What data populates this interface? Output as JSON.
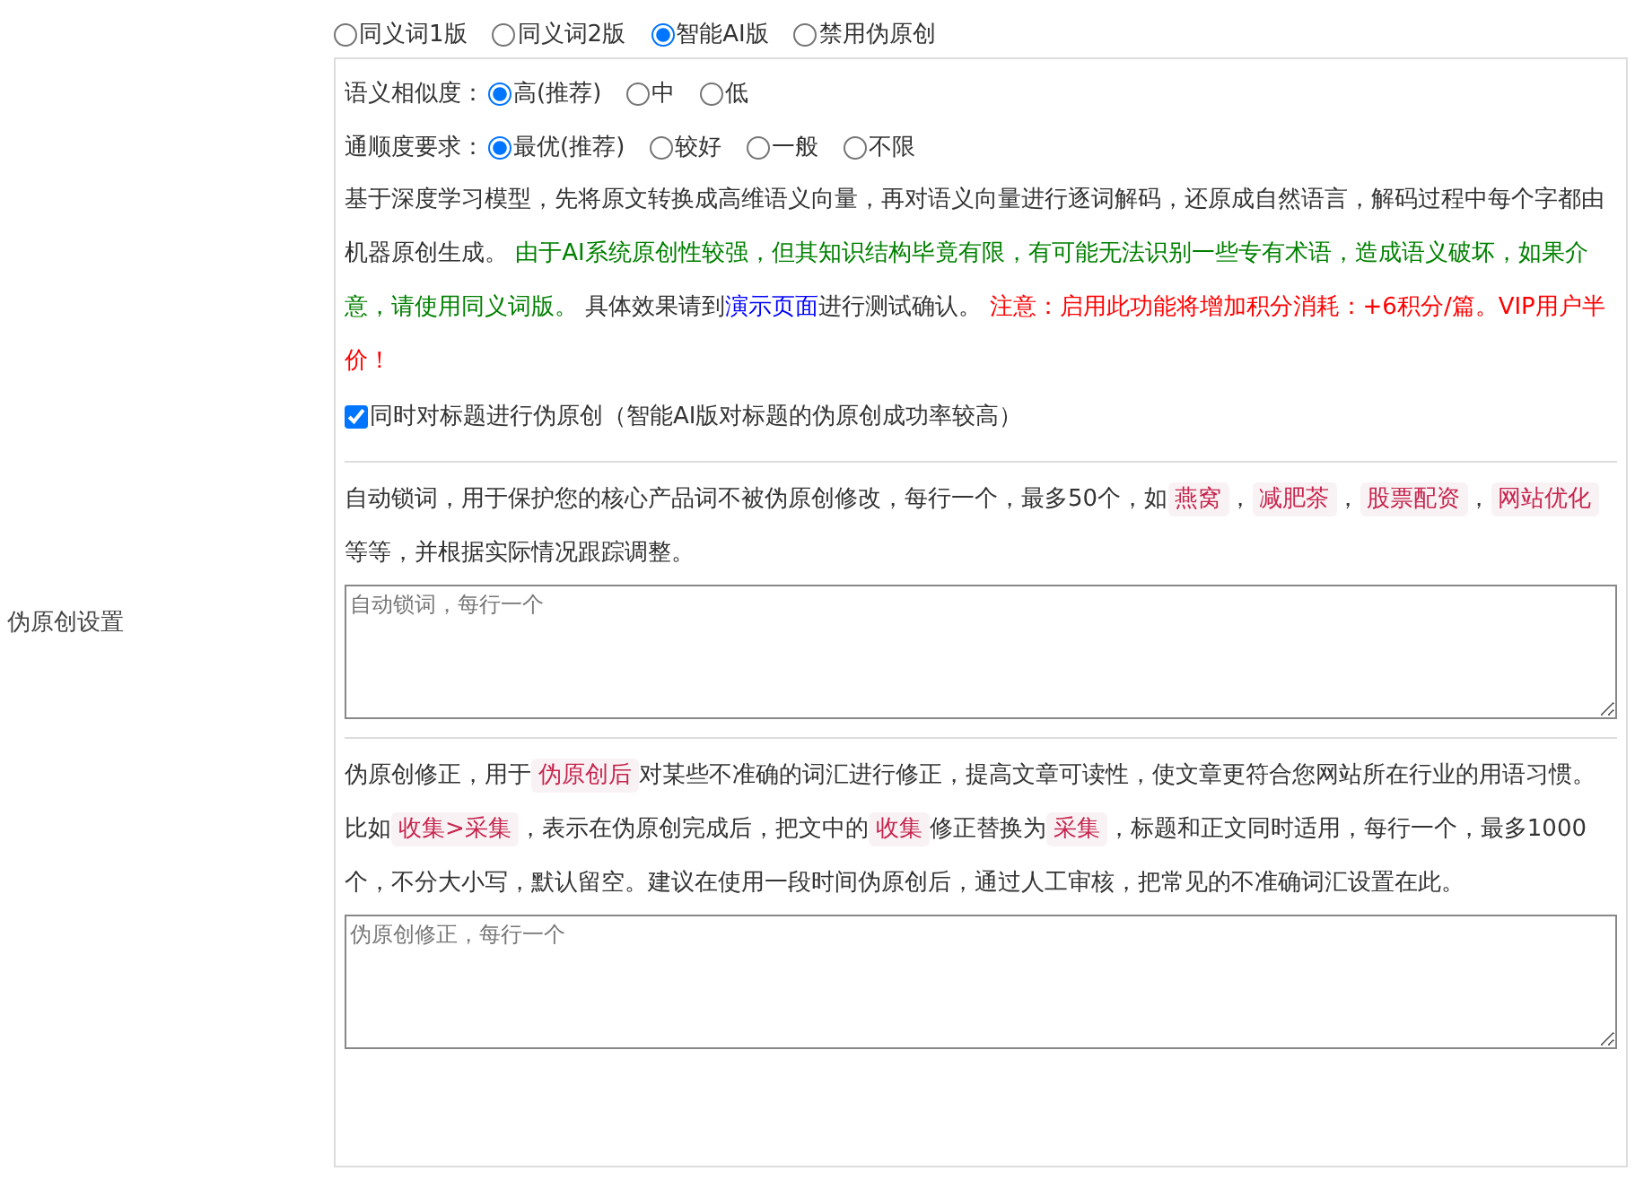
{
  "section_label": "伪原创设置",
  "mode_options": [
    {
      "label": "同义词1版",
      "selected": false
    },
    {
      "label": "同义词2版",
      "selected": false
    },
    {
      "label": "智能AI版",
      "selected": true
    },
    {
      "label": "禁用伪原创",
      "selected": false
    }
  ],
  "similarity": {
    "label": "语义相似度：",
    "options": [
      {
        "label": "高(推荐)",
        "selected": true
      },
      {
        "label": "中",
        "selected": false
      },
      {
        "label": "低",
        "selected": false
      }
    ]
  },
  "fluency": {
    "label": "通顺度要求：",
    "options": [
      {
        "label": "最优(推荐)",
        "selected": true
      },
      {
        "label": "较好",
        "selected": false
      },
      {
        "label": "一般",
        "selected": false
      },
      {
        "label": "不限",
        "selected": false
      }
    ]
  },
  "ai_description": [
    {
      "kind": "text",
      "text": "基于深度学习模型，先将原文转换成高维语义向量，再对语义向量进行逐词解码，还原成自然语言，解码过程中每个字都由机器原创生成。 "
    },
    {
      "kind": "green",
      "text": "由于AI系统原创性较强，但其知识结构毕竟有限，有可能无法识别一些专有术语，造成语义破坏，如果介意，请使用同义词版。"
    },
    {
      "kind": "text",
      "text": " 具体效果请到"
    },
    {
      "kind": "link",
      "text": "演示页面"
    },
    {
      "kind": "text",
      "text": "进行测试确认。 "
    },
    {
      "kind": "red",
      "text": "注意：启用此功能将增加积分消耗：+6积分/篇。VIP用户半价！"
    }
  ],
  "title_option": {
    "label": "同时对标题进行伪原创（智能AI版对标题的伪原创成功率较高）",
    "checked": true
  },
  "auto_lock": {
    "description": [
      {
        "kind": "text",
        "text": "自动锁词，用于保护您的核心产品词不被伪原创修改，每行一个，最多50个，如"
      },
      {
        "kind": "tag",
        "text": "燕窝"
      },
      {
        "kind": "text",
        "text": "，"
      },
      {
        "kind": "tag",
        "text": "减肥茶"
      },
      {
        "kind": "text",
        "text": "，"
      },
      {
        "kind": "tag",
        "text": "股票配资"
      },
      {
        "kind": "text",
        "text": "，"
      },
      {
        "kind": "tag",
        "text": "网站优化"
      },
      {
        "kind": "text",
        "text": " 等等，并根据实际情况跟踪调整。"
      }
    ],
    "placeholder": "自动锁词，每行一个"
  },
  "correction": {
    "description": [
      {
        "kind": "text",
        "text": "伪原创修正，用于"
      },
      {
        "kind": "tag",
        "text": "伪原创后"
      },
      {
        "kind": "text",
        "text": "对某些不准确的词汇进行修正，提高文章可读性，使文章更符合您网站所在行业的用语习惯。比如"
      },
      {
        "kind": "tag",
        "text": "收集>采集"
      },
      {
        "kind": "text",
        "text": "，表示在伪原创完成后，把文中的"
      },
      {
        "kind": "tag",
        "text": "收集"
      },
      {
        "kind": "text",
        "text": "修正替换为"
      },
      {
        "kind": "tag",
        "text": "采集"
      },
      {
        "kind": "text",
        "text": "，标题和正文同时适用，每行一个，最多1000个，不分大小写，默认留空。建议在使用一段时间伪原创后，通过人工审核，把常见的不准确词汇设置在此。"
      }
    ],
    "placeholder": "伪原创修正，每行一个"
  }
}
